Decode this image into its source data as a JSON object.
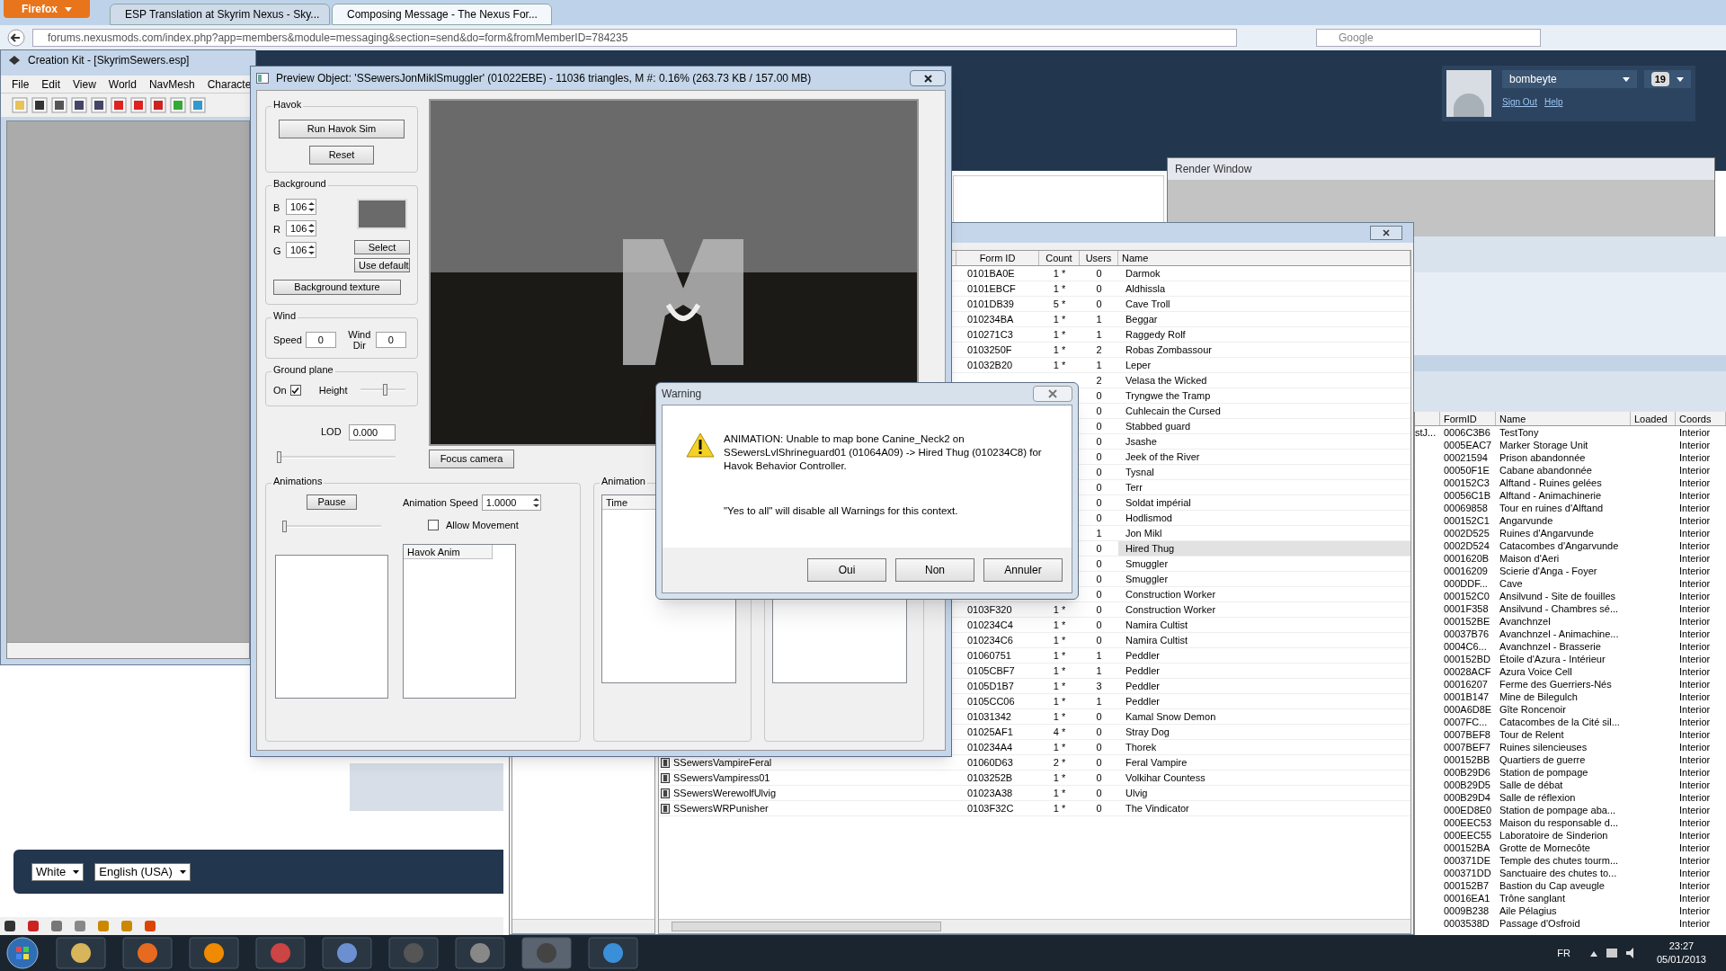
{
  "browser": {
    "menu_button": "Firefox",
    "tabs": [
      {
        "title": "ESP Translation at Skyrim Nexus - Sky...",
        "selected": false
      },
      {
        "title": "Composing Message - The Nexus For...",
        "selected": true
      }
    ],
    "url": "forums.nexusmods.com/index.php?app=members&module=messaging&section=send&do=form&fromMemberID=784235",
    "search": {
      "placeholder": "Google"
    }
  },
  "profile": {
    "username": "bombeyte",
    "badge": "19",
    "links": [
      "Sign Out",
      "Help"
    ]
  },
  "page_footer": {
    "selects": [
      "White",
      "English (USA)"
    ]
  },
  "creation_kit": {
    "title": "Creation Kit - [SkyrimSewers.esp]",
    "menu": [
      "File",
      "Edit",
      "View",
      "World",
      "NavMesh",
      "Characte"
    ]
  },
  "preview": {
    "title": "Preview Object: 'SSewersJonMiklSmuggler' (01022EBE) - 11036 triangles, M #: 0.16% (263.73 KB / 157.00 MB)",
    "havok": {
      "label": "Havok",
      "buttons": [
        "Run Havok Sim",
        "Reset"
      ]
    },
    "background": {
      "label": "Background",
      "channels": [
        {
          "label": "B",
          "value": "106"
        },
        {
          "label": "R",
          "value": "106"
        },
        {
          "label": "G",
          "value": "106"
        }
      ],
      "buttons": [
        "Select",
        "Use default"
      ],
      "texture_button": "Background texture"
    },
    "wind": {
      "label": "Wind",
      "speed_label": "Speed",
      "speed": "0",
      "dir_label": "Wind Dir",
      "dir": "0"
    },
    "ground_plane": {
      "label": "Ground plane",
      "on_label": "On",
      "on": true,
      "height_label": "Height",
      "level": 0.55
    },
    "lod": {
      "label": "LOD",
      "value": "0.000",
      "level": 0.02
    },
    "focus_button": "Focus camera",
    "animations": {
      "label": "Animations",
      "pause": "Pause",
      "level": 0.02,
      "speed_label": "Animation Speed",
      "speed": "1.0000",
      "allow_movement": {
        "label": "Allow Movement",
        "checked": false
      },
      "list_header": "Havok Anim"
    },
    "animation_panel": {
      "label": "Animation",
      "list_header": "Time"
    }
  },
  "render_window": {
    "title": "Render Window"
  },
  "object_list": {
    "columns": [
      "Form ID",
      "Count",
      "Users",
      "Name"
    ],
    "rows": [
      {
        "form_id": "0101BA0E",
        "count": "1 *",
        "users": "0",
        "name": "Darmok",
        "selected": false
      },
      {
        "form_id": "0101EBCF",
        "count": "1 *",
        "users": "0",
        "name": "Aldhissla",
        "selected": false
      },
      {
        "form_id": "0101DB39",
        "count": "5 *",
        "users": "0",
        "name": "Cave Troll",
        "selected": false
      },
      {
        "form_id": "010234BA",
        "count": "1 *",
        "users": "1",
        "name": "Beggar",
        "selected": false
      },
      {
        "form_id": "010271C3",
        "count": "1 *",
        "users": "1",
        "name": "Raggedy Rolf",
        "selected": false
      },
      {
        "form_id": "0103250F",
        "count": "1 *",
        "users": "2",
        "name": "Robas Zombassour",
        "selected": false
      },
      {
        "form_id": "01032B20",
        "count": "1 *",
        "users": "1",
        "name": "Leper",
        "selected": false
      },
      {
        "users": "2",
        "name": "Velasa the Wicked",
        "selected": false
      },
      {
        "users": "0",
        "name": "Tryngwe the Tramp",
        "selected": false
      },
      {
        "users": "0",
        "name": "Cuhlecain the Cursed",
        "selected": false
      },
      {
        "users": "0",
        "name": "Stabbed guard",
        "selected": false
      },
      {
        "users": "0",
        "name": "Jsashe",
        "selected": false
      },
      {
        "users": "0",
        "name": "Jeek of the River",
        "selected": false
      },
      {
        "users": "0",
        "name": "Tysnal",
        "selected": false
      },
      {
        "users": "0",
        "name": "Terr",
        "selected": false
      },
      {
        "users": "0",
        "name": "Soldat impérial",
        "selected": false
      },
      {
        "users": "0",
        "name": "Hodlismod",
        "selected": false
      },
      {
        "users": "1",
        "name": "Jon Mikl",
        "selected": false
      },
      {
        "users": "0",
        "name": "Hired Thug",
        "selected": true
      },
      {
        "users": "0",
        "name": "Smuggler",
        "selected": false
      },
      {
        "users": "0",
        "name": "Smuggler",
        "selected": false
      },
      {
        "users": "0",
        "name": "Construction Worker",
        "selected": false
      },
      {
        "form_id": "0103F320",
        "count": "1 *",
        "users": "0",
        "name": "Construction Worker",
        "selected": false
      },
      {
        "form_id": "010234C4",
        "count": "1 *",
        "users": "0",
        "name": "Namira Cultist",
        "selected": false
      },
      {
        "form_id": "010234C6",
        "count": "1 *",
        "users": "0",
        "name": "Namira Cultist",
        "selected": false
      },
      {
        "form_id": "01060751",
        "count": "1 *",
        "users": "1",
        "name": "Peddler",
        "selected": false
      },
      {
        "form_id": "0105CBF7",
        "count": "1 *",
        "users": "1",
        "name": "Peddler",
        "selected": false
      },
      {
        "form_id": "0105D1B7",
        "count": "1 *",
        "users": "3",
        "name": "Peddler",
        "selected": false
      },
      {
        "form_id": "0105CC06",
        "count": "1 *",
        "users": "1",
        "name": "Peddler",
        "selected": false
      },
      {
        "form_id": "01031342",
        "count": "1 *",
        "users": "0",
        "name": "Kamal Snow Demon",
        "selected": false
      },
      {
        "form_id": "01025AF1",
        "count": "4 *",
        "users": "0",
        "name": "Stray Dog",
        "selected": false
      },
      {
        "form_id": "010234A4",
        "count": "1 *",
        "users": "0",
        "name": "Thorek",
        "selected": false
      },
      {
        "editor_id": "SSewersVampireFeral",
        "form_id": "01060D63",
        "count": "2 *",
        "users": "0",
        "name": "Feral Vampire",
        "selected": false
      },
      {
        "editor_id": "SSewersVampiress01",
        "form_id": "0103252B",
        "count": "1 *",
        "users": "0",
        "name": "Volkihar Countess",
        "selected": false
      },
      {
        "editor_id": "SSewersWerewolfUlvig",
        "form_id": "01023A38",
        "count": "1 *",
        "users": "0",
        "name": "Ulvig",
        "selected": false
      },
      {
        "editor_id": "SSewersWRPunisher",
        "form_id": "0103F32C",
        "count": "1 *",
        "users": "0",
        "name": "The Vindicator",
        "selected": false
      }
    ]
  },
  "cell_list": {
    "columns": [
      "FormID",
      "Name",
      "Loaded",
      "Coords"
    ],
    "rows": [
      {
        "column_1": "stJ...",
        "form_id": "0006C3B6",
        "name": "TestTony",
        "coords": "Interior"
      },
      {
        "form_id": "0005EAC7",
        "name": "Marker Storage Unit",
        "coords": "Interior"
      },
      {
        "form_id": "00021594",
        "name": "Prison abandonnée",
        "coords": "Interior"
      },
      {
        "form_id": "00050F1E",
        "name": "Cabane abandonnée",
        "coords": "Interior"
      },
      {
        "form_id": "000152C3",
        "name": "Alftand - Ruines gelées",
        "coords": "Interior"
      },
      {
        "form_id": "00056C1B",
        "name": "Alftand - Animachinerie",
        "coords": "Interior"
      },
      {
        "form_id": "00069858",
        "name": "Tour en ruines d'Alftand",
        "coords": "Interior"
      },
      {
        "form_id": "000152C1",
        "name": "Angarvunde",
        "coords": "Interior"
      },
      {
        "form_id": "0002D525",
        "name": "Ruines d'Angarvunde",
        "coords": "Interior"
      },
      {
        "form_id": "0002D524",
        "name": "Catacombes d'Angarvunde",
        "coords": "Interior"
      },
      {
        "form_id": "0001620B",
        "name": "Maison d'Aeri",
        "coords": "Interior"
      },
      {
        "form_id": "00016209",
        "name": "Scierie d'Anga - Foyer",
        "coords": "Interior"
      },
      {
        "form_id": "000DDF...",
        "name": "Cave",
        "coords": "Interior"
      },
      {
        "form_id": "000152C0",
        "name": "Ansilvund - Site de fouilles",
        "coords": "Interior"
      },
      {
        "form_id": "0001F358",
        "name": "Ansilvund - Chambres sé...",
        "coords": "Interior"
      },
      {
        "form_id": "000152BE",
        "name": "Avanchnzel",
        "coords": "Interior"
      },
      {
        "form_id": "00037B76",
        "name": "Avanchnzel - Animachine...",
        "coords": "Interior"
      },
      {
        "form_id": "0004C6...",
        "name": "Avanchnzel - Brasserie",
        "coords": "Interior"
      },
      {
        "form_id": "000152BD",
        "name": "Étoile d'Azura - Intérieur",
        "coords": "Interior"
      },
      {
        "form_id": "00028ACF",
        "name": "Azura Voice Cell",
        "coords": "Interior"
      },
      {
        "form_id": "00016207",
        "name": "Ferme des Guerriers-Nés",
        "coords": "Interior"
      },
      {
        "form_id": "0001B147",
        "name": "Mine de Bilegulch",
        "coords": "Interior"
      },
      {
        "form_id": "000A6D8E",
        "name": "Gîte Roncenoir",
        "coords": "Interior"
      },
      {
        "form_id": "0007FC...",
        "name": "Catacombes de la Cité sil...",
        "coords": "Interior"
      },
      {
        "form_id": "0007BEF8",
        "name": "Tour de Relent",
        "coords": "Interior"
      },
      {
        "form_id": "0007BEF7",
        "name": "Ruines silencieuses",
        "coords": "Interior"
      },
      {
        "form_id": "000152BB",
        "name": "Quartiers de guerre",
        "coords": "Interior"
      },
      {
        "form_id": "000B29D6",
        "name": "Station de pompage",
        "coords": "Interior"
      },
      {
        "form_id": "000B29D5",
        "name": "Salle de débat",
        "coords": "Interior"
      },
      {
        "form_id": "000B29D4",
        "name": "Salle de réflexion",
        "coords": "Interior"
      },
      {
        "form_id": "000ED8E0",
        "name": "Station de pompage aba...",
        "coords": "Interior"
      },
      {
        "form_id": "000EEC53",
        "name": "Maison du responsable d...",
        "coords": "Interior"
      },
      {
        "form_id": "000EEC55",
        "name": "Laboratoire de Sinderion",
        "coords": "Interior"
      },
      {
        "form_id": "000152BA",
        "name": "Grotte de Mornecôte",
        "coords": "Interior"
      },
      {
        "form_id": "000371DE",
        "name": "Temple des chutes tourm...",
        "coords": "Interior"
      },
      {
        "form_id": "000371DD",
        "name": "Sanctuaire des chutes to...",
        "coords": "Interior"
      },
      {
        "form_id": "000152B7",
        "name": "Bastion du Cap aveugle",
        "coords": "Interior"
      },
      {
        "form_id": "00016EA1",
        "name": "Trône sanglant",
        "coords": "Interior"
      },
      {
        "form_id": "0009B238",
        "name": "Aile Pélagius",
        "coords": "Interior"
      },
      {
        "form_id": "0003538D",
        "name": "Passage d'Osfroid",
        "coords": "Interior"
      }
    ]
  },
  "warning": {
    "title": "Warning",
    "message": "ANIMATION: Unable to map bone Canine_Neck2 on SSewersLvlShrineguard01 (01064A09) -> Hired Thug (010234C8) for Havok Behavior Controller.",
    "note": "\"Yes to all\" will disable all Warnings for this context.",
    "buttons": [
      "Oui",
      "Non",
      "Annuler"
    ]
  },
  "taskbar": {
    "language": "FR",
    "time": "23:27",
    "date": "05/01/2013"
  }
}
